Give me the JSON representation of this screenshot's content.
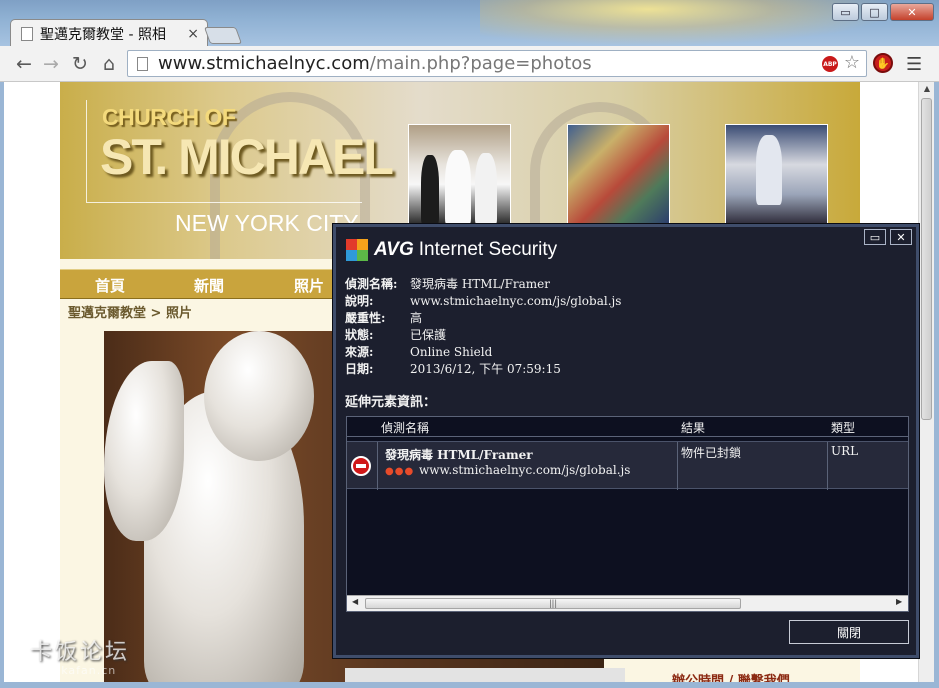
{
  "browser": {
    "tab_title": "聖邁克爾教堂 - 照相",
    "tab_close": "×",
    "url_domain": "www.stmichaelnyc.com",
    "url_rest": "/main.php?page=photos",
    "window_buttons": [
      "▭",
      "□",
      "✕"
    ],
    "abp_label": "ABP"
  },
  "site": {
    "logo_line1": "CHURCH OF",
    "logo_line2": "ST. MICHAEL",
    "logo_city": "NEW YORK CITY",
    "nav": [
      "首頁",
      "新聞",
      "照片"
    ],
    "breadcrumb": "聖邁克爾教堂 > 照片",
    "footer_text": "辦公時間 / 聯繫我們"
  },
  "watermark": {
    "text": "卡饭论坛",
    "sub": "bbs.kafan.cn"
  },
  "avg": {
    "brand_bold": "AVG",
    "brand_rest": "Internet Security",
    "details": [
      {
        "k": "偵測名稱:",
        "v": "發現病毒 HTML/Framer"
      },
      {
        "k": "說明:",
        "v": "www.stmichaelnyc.com/js/global.js"
      },
      {
        "k": "嚴重性:",
        "v": "高"
      },
      {
        "k": "狀態:",
        "v": "已保護"
      },
      {
        "k": "來源:",
        "v": "Online Shield"
      },
      {
        "k": "日期:",
        "v": "2013/6/12, 下午 07:59:15"
      }
    ],
    "extended_heading": "延伸元素資訊：",
    "columns": [
      "偵測名稱",
      "結果",
      "類型"
    ],
    "row": {
      "threat": "發現病毒 HTML/Framer",
      "dots": "●●●",
      "path": "www.stmichaelnyc.com/js/global.js",
      "result": "物件已封鎖",
      "type": "URL"
    },
    "close_label": "關閉"
  }
}
